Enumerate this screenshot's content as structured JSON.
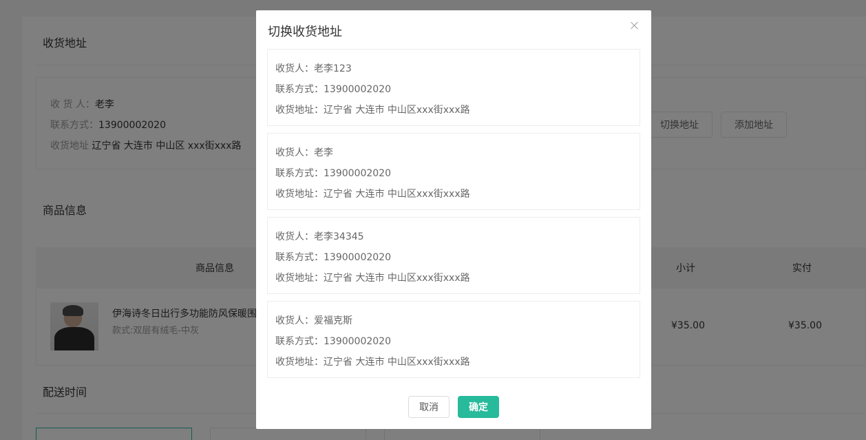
{
  "page": {
    "address_section": {
      "title": "收货地址",
      "receiver_label": "收 货 人：",
      "receiver_value": "老李",
      "contact_label": "联系方式：",
      "contact_value": "13900002020",
      "address_label": "收货地址",
      "address_value": "辽宁省 大连市 中山区 xxx街xxx路",
      "switch_button": "切换地址",
      "add_button": "添加地址"
    },
    "goods_section": {
      "title": "商品信息",
      "columns": [
        "商品信息",
        "小计",
        "实付"
      ],
      "item": {
        "name": "伊海诗冬日出行多功能防风保暖围",
        "spec": "款式:双层有绒毛-中灰",
        "subtotal": "¥35.00",
        "paid": "¥35.00"
      }
    },
    "delivery_section": {
      "title": "配送时间"
    }
  },
  "dialog": {
    "title": "切换收货地址",
    "addresses": [
      {
        "receiver": "收货人：老李123",
        "contact": "联系方式：13900002020",
        "address": "收货地址：辽宁省 大连市 中山区xxx街xxx路"
      },
      {
        "receiver": "收货人：老李",
        "contact": "联系方式：13900002020",
        "address": "收货地址：辽宁省 大连市 中山区xxx街xxx路"
      },
      {
        "receiver": "收货人：老李34345",
        "contact": "联系方式：13900002020",
        "address": "收货地址：辽宁省 大连市 中山区xxx街xxx路"
      },
      {
        "receiver": "收货人：爱福克斯",
        "contact": "联系方式：13900002020",
        "address": "收货地址：辽宁省 大连市 中山区xxx街xxx路"
      }
    ],
    "cancel_label": "取消",
    "confirm_label": "确定"
  },
  "colors": {
    "accent": "#27ba9b",
    "mask": "rgba(0,0,0,0.5)"
  },
  "icons": {
    "close": "close-icon"
  }
}
